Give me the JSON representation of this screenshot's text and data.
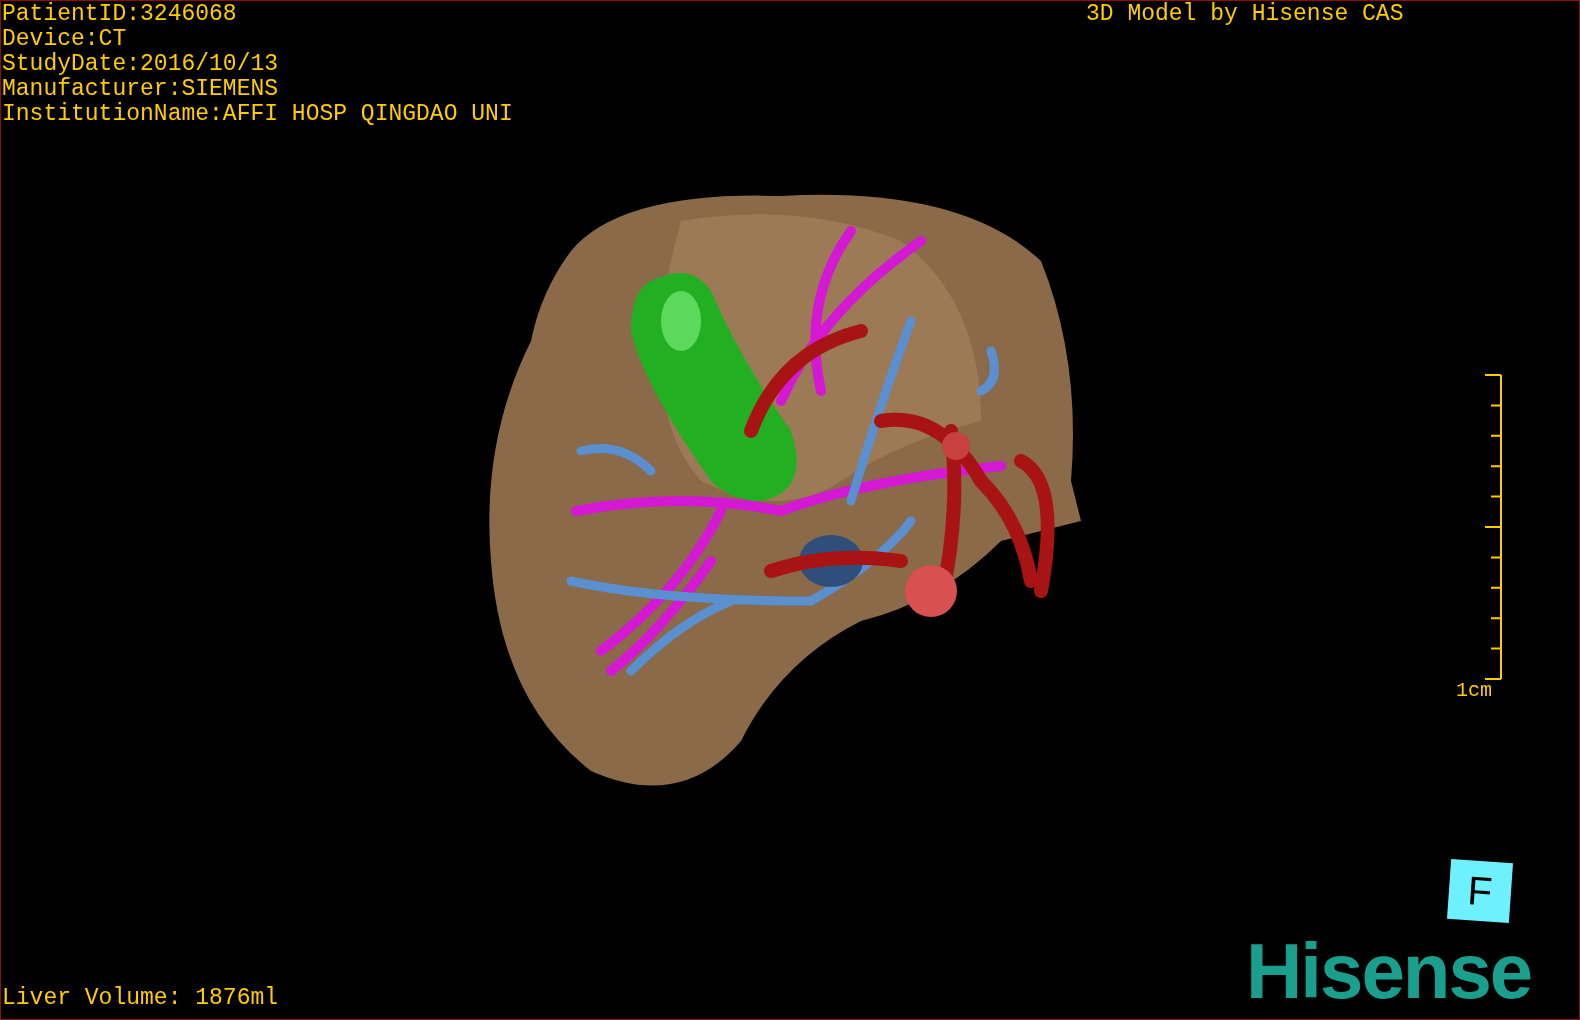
{
  "info_lines": [
    "PatientID:3246068",
    "Device:CT",
    "StudyDate:2016/10/13",
    "Manufacturer:SIEMENS",
    "InstitutionName:AFFI HOSP QINGDAO UNI"
  ],
  "title": "3D Model by Hisense CAS",
  "scale_bar": {
    "label": "1cm"
  },
  "orientation_cube": {
    "label": "F"
  },
  "footer": {
    "volume": "Liver Volume: 1876ml"
  },
  "logo": {
    "text": "Hisense"
  }
}
